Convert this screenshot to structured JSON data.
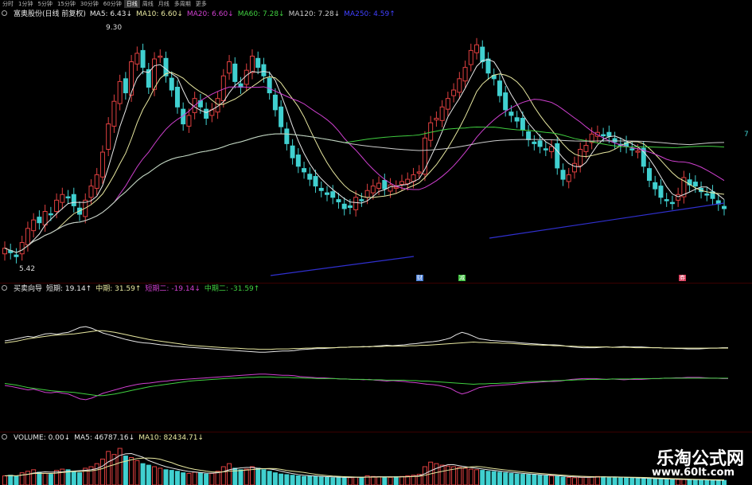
{
  "tabs": [
    "分时",
    "1分钟",
    "5分钟",
    "15分钟",
    "30分钟",
    "60分钟",
    "日线",
    "周线",
    "月线",
    "多周期",
    "更多"
  ],
  "active_tab": 6,
  "main_legend": {
    "stock": "富奥股份(日线 前复权)",
    "items": [
      {
        "text": "MA5: 6.43↓",
        "color": "#e8e8e8"
      },
      {
        "text": "MA10: 6.60↓",
        "color": "#e8e8a0"
      },
      {
        "text": "MA20: 6.60↓",
        "color": "#d040d0"
      },
      {
        "text": "MA60: 7.28↓",
        "color": "#40d040"
      },
      {
        "text": "MA120: 7.28↓",
        "color": "#cccccc"
      },
      {
        "text": "MA250: 4.59↑",
        "color": "#4040ff"
      }
    ]
  },
  "price_labels": {
    "high": "9.30",
    "low": "5.42",
    "right": "7"
  },
  "markers": [
    {
      "text": "财",
      "color": "#4a7fd8"
    },
    {
      "text": "减",
      "color": "#3cbf3c"
    },
    {
      "text": "券",
      "color": "#d83c5a"
    }
  ],
  "indicator_legend": {
    "name": "买卖向导",
    "items": [
      {
        "text": "短期: 19.14↑",
        "color": "#e8e8e8"
      },
      {
        "text": "中期: 31.59↑",
        "color": "#e8e8a0"
      },
      {
        "text": "短期二: -19.14↓",
        "color": "#d040d0"
      },
      {
        "text": "中期二: -31.59↑",
        "color": "#40d040"
      }
    ]
  },
  "volume_legend": {
    "items": [
      {
        "text": "VOLUME: 0.00↓",
        "color": "#e8e8e8"
      },
      {
        "text": "MA5: 46787.16↓",
        "color": "#e8e8e8"
      },
      {
        "text": "MA10: 82434.71↓",
        "color": "#e8e8a0"
      }
    ]
  },
  "watermark": {
    "title": "乐淘公式网",
    "url": "www.60lt.com"
  },
  "colors": {
    "up": "#e04040",
    "down": "#40d0d0",
    "background": "#000000"
  },
  "series": {
    "prices": [
      5.6,
      5.52,
      5.45,
      5.7,
      5.95,
      6.1,
      6.05,
      6.25,
      6.2,
      6.45,
      6.55,
      6.5,
      6.35,
      6.2,
      6.45,
      6.7,
      6.9,
      7.3,
      7.8,
      8.2,
      8.55,
      8.35,
      8.9,
      9.05,
      8.8,
      8.45,
      8.95,
      9.0,
      8.65,
      8.4,
      8.1,
      7.8,
      7.95,
      8.25,
      8.1,
      7.9,
      8.05,
      8.25,
      8.65,
      8.9,
      8.55,
      8.45,
      8.75,
      9.0,
      8.8,
      8.65,
      8.35,
      8.05,
      7.75,
      7.45,
      7.2,
      7.05,
      6.95,
      6.82,
      6.7,
      6.62,
      6.55,
      6.5,
      6.42,
      6.3,
      6.32,
      6.5,
      6.45,
      6.62,
      6.7,
      6.75,
      6.65,
      6.72,
      6.68,
      6.78,
      6.82,
      6.9,
      6.95,
      7.55,
      7.82,
      7.9,
      8.1,
      8.25,
      8.4,
      8.6,
      8.8,
      9.1,
      9.2,
      8.9,
      8.7,
      8.6,
      8.3,
      8.05,
      7.95,
      7.85,
      7.7,
      7.52,
      7.45,
      7.4,
      7.35,
      7.4,
      7.02,
      6.82,
      6.9,
      7.1,
      7.35,
      7.42,
      7.62,
      7.65,
      7.6,
      7.58,
      7.48,
      7.42,
      7.4,
      7.35,
      7.32,
      7.05,
      6.8,
      6.65,
      6.5,
      6.45,
      6.4,
      6.55,
      6.85,
      6.72,
      6.7,
      6.6,
      6.55,
      6.48,
      6.38,
      6.3
    ],
    "short": [
      55,
      57,
      60,
      63,
      66,
      64,
      68,
      72,
      73,
      71,
      74,
      76,
      82,
      88,
      90,
      86,
      80,
      74,
      70,
      66,
      62,
      58,
      55,
      52,
      50,
      49,
      47,
      45,
      44,
      42,
      41,
      40,
      39,
      38,
      37,
      36,
      35,
      34,
      33,
      32,
      31,
      30,
      29,
      28,
      27,
      27,
      28,
      29,
      30,
      30,
      31,
      33,
      34,
      35,
      36,
      36,
      37,
      38,
      39,
      39,
      40,
      40,
      41,
      40,
      42,
      43,
      44,
      43,
      44,
      45,
      47,
      48,
      50,
      52,
      53,
      55,
      58,
      62,
      70,
      76,
      72,
      66,
      60,
      58,
      56,
      55,
      54,
      53,
      52,
      50,
      49,
      48,
      47,
      46,
      45,
      45,
      44,
      42,
      40,
      39,
      38,
      38,
      38,
      39,
      40,
      39,
      40,
      41,
      40,
      40,
      40,
      39,
      38,
      38,
      37,
      37,
      36,
      36,
      35,
      35,
      35,
      36,
      37,
      37,
      38,
      38
    ],
    "medium": [
      50,
      52,
      54,
      57,
      60,
      62,
      64,
      66,
      68,
      69,
      70,
      71,
      72,
      74,
      76,
      78,
      80,
      80,
      78,
      76,
      73,
      70,
      67,
      64,
      61,
      58,
      56,
      54,
      52,
      50,
      48,
      46,
      44,
      43,
      42,
      41,
      40,
      39,
      38,
      37,
      37,
      36,
      35,
      35,
      34,
      34,
      34,
      35,
      35,
      35,
      36,
      36,
      37,
      37,
      38,
      38,
      38,
      38,
      39,
      39,
      40,
      40,
      40,
      41,
      41,
      41,
      42,
      42,
      42,
      42,
      43,
      43,
      44,
      44,
      45,
      46,
      47,
      48,
      49,
      50,
      51,
      52,
      51,
      51,
      50,
      50,
      49,
      49,
      48,
      47,
      46,
      45,
      45,
      44,
      44,
      43,
      43,
      42,
      42,
      41,
      41,
      40,
      40,
      40,
      40,
      39,
      39,
      39,
      39,
      38,
      38,
      38,
      38,
      38,
      37,
      37,
      37,
      37,
      37,
      37,
      37,
      37,
      37,
      37,
      37,
      37
    ],
    "short2": [
      -55,
      -57,
      -60,
      -63,
      -66,
      -64,
      -68,
      -72,
      -73,
      -71,
      -74,
      -76,
      -82,
      -88,
      -90,
      -86,
      -80,
      -74,
      -70,
      -66,
      -62,
      -58,
      -55,
      -52,
      -50,
      -49,
      -47,
      -45,
      -44,
      -42,
      -41,
      -40,
      -39,
      -38,
      -37,
      -36,
      -35,
      -34,
      -33,
      -32,
      -31,
      -30,
      -29,
      -28,
      -27,
      -27,
      -28,
      -29,
      -30,
      -30,
      -31,
      -33,
      -34,
      -35,
      -36,
      -36,
      -37,
      -38,
      -39,
      -39,
      -40,
      -40,
      -41,
      -40,
      -42,
      -43,
      -44,
      -43,
      -44,
      -45,
      -47,
      -48,
      -50,
      -52,
      -53,
      -55,
      -58,
      -62,
      -70,
      -76,
      -72,
      -66,
      -60,
      -58,
      -56,
      -55,
      -54,
      -53,
      -52,
      -50,
      -49,
      -48,
      -47,
      -46,
      -45,
      -45,
      -44,
      -42,
      -40,
      -39,
      -38,
      -38,
      -38,
      -39,
      -40,
      -39,
      -40,
      -41,
      -40,
      -40,
      -40,
      -39,
      -38,
      -38,
      -37,
      -37,
      -36,
      -36,
      -35,
      -35,
      -35,
      -36,
      -37,
      -37,
      -38,
      -38
    ],
    "medium2": [
      -50,
      -52,
      -54,
      -57,
      -60,
      -62,
      -64,
      -66,
      -68,
      -69,
      -70,
      -71,
      -72,
      -74,
      -76,
      -78,
      -80,
      -80,
      -78,
      -76,
      -73,
      -70,
      -67,
      -64,
      -61,
      -58,
      -56,
      -54,
      -52,
      -50,
      -48,
      -46,
      -44,
      -43,
      -42,
      -41,
      -40,
      -39,
      -38,
      -37,
      -37,
      -36,
      -35,
      -35,
      -34,
      -34,
      -34,
      -35,
      -35,
      -35,
      -36,
      -36,
      -37,
      -37,
      -38,
      -38,
      -38,
      -38,
      -39,
      -39,
      -40,
      -40,
      -40,
      -41,
      -41,
      -41,
      -42,
      -42,
      -42,
      -42,
      -43,
      -43,
      -44,
      -44,
      -45,
      -46,
      -47,
      -48,
      -49,
      -50,
      -51,
      -52,
      -51,
      -51,
      -50,
      -50,
      -49,
      -49,
      -48,
      -47,
      -46,
      -45,
      -45,
      -44,
      -44,
      -43,
      -43,
      -42,
      -42,
      -41,
      -41,
      -40,
      -40,
      -40,
      -40,
      -39,
      -39,
      -39,
      -39,
      -38,
      -38,
      -38,
      -38,
      -38,
      -37,
      -37,
      -37,
      -37,
      -37,
      -37,
      -37,
      -37,
      -37,
      -37,
      -37,
      -37
    ],
    "volume": [
      30,
      32,
      28,
      40,
      45,
      50,
      42,
      38,
      35,
      48,
      52,
      50,
      44,
      40,
      55,
      60,
      70,
      85,
      110,
      100,
      120,
      95,
      90,
      80,
      70,
      65,
      60,
      55,
      50,
      48,
      45,
      40,
      38,
      42,
      40,
      36,
      38,
      45,
      60,
      70,
      55,
      50,
      52,
      60,
      55,
      50,
      45,
      40,
      36,
      34,
      32,
      30,
      28,
      30,
      28,
      26,
      25,
      24,
      26,
      25,
      24,
      26,
      25,
      30,
      28,
      27,
      26,
      25,
      27,
      28,
      30,
      32,
      35,
      60,
      75,
      70,
      65,
      62,
      60,
      58,
      55,
      52,
      50,
      48,
      45,
      44,
      42,
      40,
      38,
      36,
      35,
      34,
      33,
      32,
      30,
      30,
      28,
      26,
      25,
      24,
      25,
      26,
      27,
      28,
      27,
      26,
      25,
      24,
      24,
      23,
      22,
      21,
      20,
      20,
      19,
      19,
      18,
      18,
      18,
      17,
      17,
      16,
      16,
      15,
      15,
      15
    ]
  }
}
